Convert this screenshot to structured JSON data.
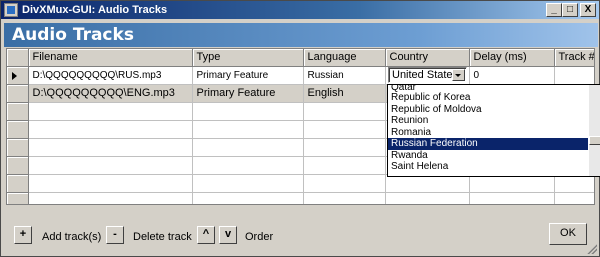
{
  "window": {
    "title": "DivXMux-GUI: Audio Tracks",
    "buttons": {
      "minimize": "_",
      "maximize": "□",
      "close": "X"
    }
  },
  "banner": {
    "heading": "Audio Tracks"
  },
  "grid": {
    "columns": [
      "Filename",
      "Type",
      "Language",
      "Country",
      "Delay (ms)",
      "Track #"
    ],
    "rows": [
      {
        "filename": "D:\\QQQQQQQQQ\\RUS.mp3",
        "type": "Primary Feature",
        "language": "Russian",
        "country": "United States",
        "delay": "0",
        "track": ""
      },
      {
        "filename": "D:\\QQQQQQQQQ\\ENG.mp3",
        "type": "Primary Feature",
        "language": "English",
        "country": "",
        "delay": "",
        "track": ""
      }
    ],
    "empty_row_count": 6
  },
  "country_dropdown": {
    "selected_value": "United States",
    "options": [
      "Qatar",
      "Republic of Korea",
      "Republic of Moldova",
      "Reunion",
      "Romania",
      "Russian Federation",
      "Rwanda",
      "Saint Helena"
    ],
    "highlighted": "Russian Federation"
  },
  "footer": {
    "add_button": "+",
    "add_label": "Add track(s)",
    "delete_button": "-",
    "delete_label": "Delete track",
    "up_button": "^",
    "down_button": "v",
    "order_label": "Order",
    "ok_button": "OK"
  }
}
